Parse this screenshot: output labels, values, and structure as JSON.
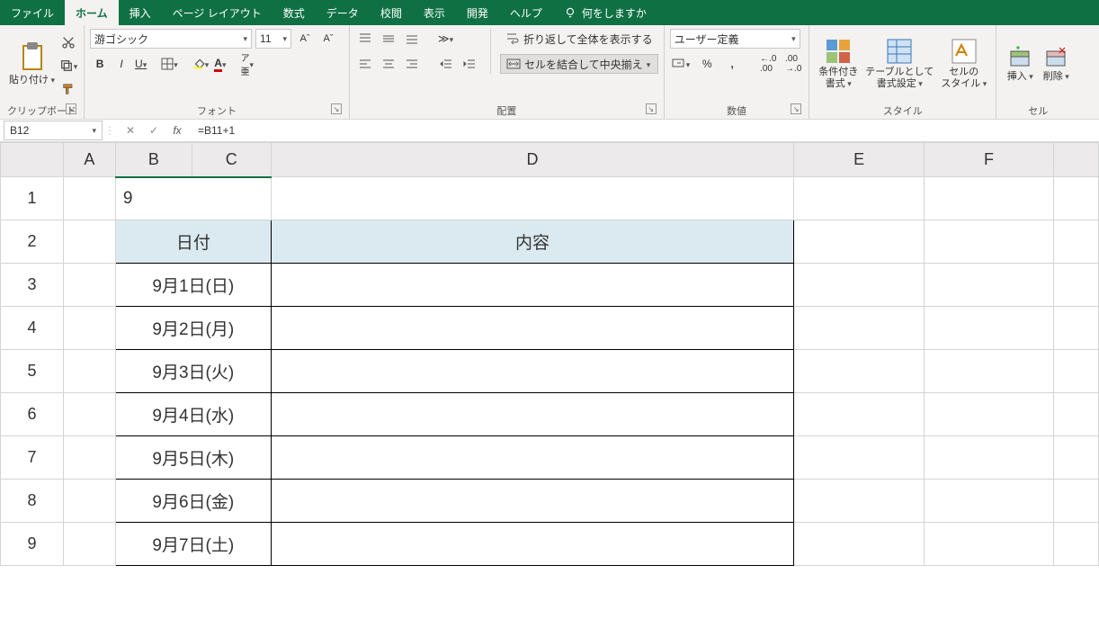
{
  "menu": {
    "tabs": [
      "ファイル",
      "ホーム",
      "挿入",
      "ページ レイアウト",
      "数式",
      "データ",
      "校閲",
      "表示",
      "開発",
      "ヘルプ"
    ],
    "active_index": 1,
    "tellme": "何をしますか"
  },
  "ribbon": {
    "clipboard": {
      "label": "クリップボード",
      "paste": "貼り付け"
    },
    "font": {
      "label": "フォント",
      "name": "游ゴシック",
      "size": "11",
      "bold": "B",
      "italic": "I",
      "underline": "U",
      "ruby": "ᵃ⁄ₓ"
    },
    "alignment": {
      "label": "配置",
      "wrap": "折り返して全体を表示する",
      "merge": "セルを結合して中央揃え"
    },
    "number": {
      "label": "数値",
      "format": "ユーザー定義"
    },
    "styles": {
      "label": "スタイル",
      "cond": "条件付き\n書式",
      "table": "テーブルとして\n書式設定",
      "cell": "セルの\nスタイル"
    },
    "cells": {
      "label": "セル",
      "insert": "挿入",
      "delete": "削除"
    }
  },
  "formula_bar": {
    "name_box": "B12",
    "formula": "=B11+1"
  },
  "grid": {
    "columns": [
      "A",
      "B",
      "C",
      "D",
      "E",
      "F"
    ],
    "rows": [
      "1",
      "2",
      "3",
      "4",
      "5",
      "6",
      "7",
      "8",
      "9"
    ],
    "b1_value": "9",
    "header_date": "日付",
    "header_content": "内容",
    "dates": [
      "9月1日(日)",
      "9月2日(月)",
      "9月3日(火)",
      "9月4日(水)",
      "9月5日(木)",
      "9月6日(金)",
      "9月7日(土)"
    ]
  }
}
